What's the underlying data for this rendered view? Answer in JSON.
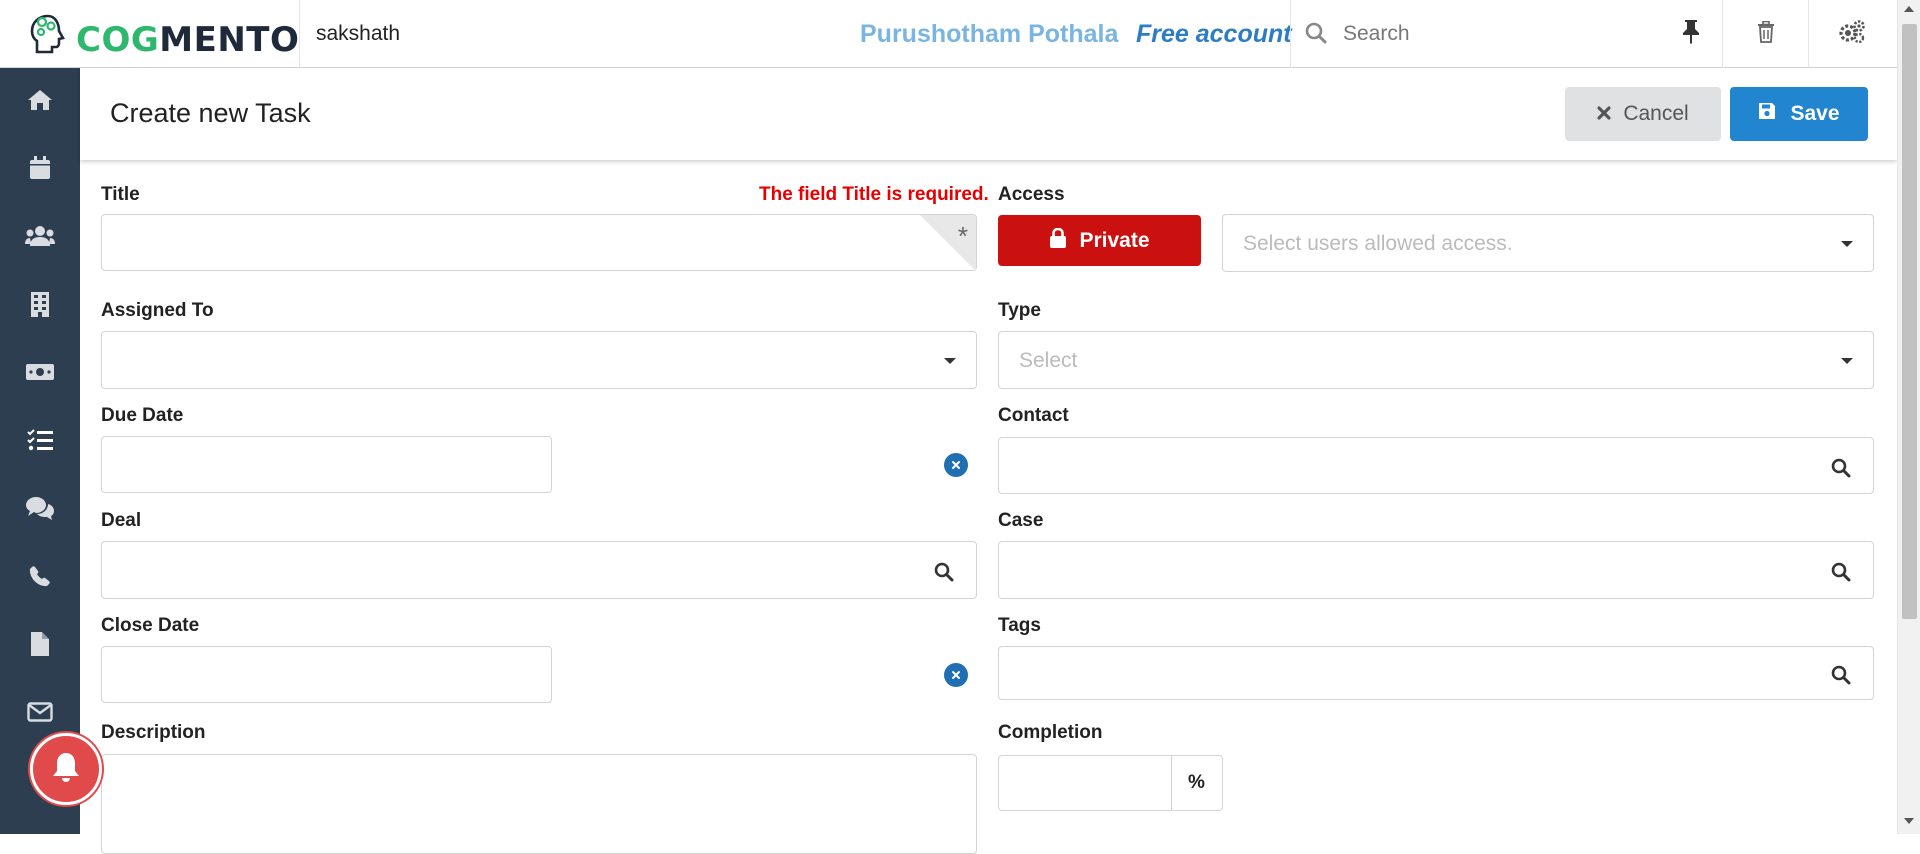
{
  "topbar": {
    "logo_prefix": "COG",
    "logo_suffix": "MENTO",
    "account_name": "sakshath",
    "user_name": "Purushotham Pothala",
    "account_type": "Free account",
    "search_placeholder": "Search",
    "icons": [
      "pin-icon",
      "trash-icon",
      "settings-gears-icon"
    ]
  },
  "sidebar": {
    "items": [
      "home-icon",
      "calendar-icon",
      "contacts-icon",
      "companies-icon",
      "deals-icon",
      "tasks-icon",
      "cases-icon",
      "calls-icon",
      "documents-icon",
      "email-icon"
    ]
  },
  "header": {
    "title": "Create new Task",
    "cancel_label": "Cancel",
    "save_label": "Save"
  },
  "form": {
    "title_label": "Title",
    "title_error": "The field Title is required.",
    "title_required_marker": "*",
    "access_label": "Access",
    "access_button": "Private",
    "access_placeholder": "Select users allowed access.",
    "assigned_to_label": "Assigned To",
    "type_label": "Type",
    "type_placeholder": "Select",
    "due_date_label": "Due Date",
    "contact_label": "Contact",
    "deal_label": "Deal",
    "case_label": "Case",
    "close_date_label": "Close Date",
    "tags_label": "Tags",
    "description_label": "Description",
    "completion_label": "Completion",
    "completion_unit": "%"
  },
  "colors": {
    "sidebar_bg": "#2d3e50",
    "save_blue": "#2185d0",
    "private_red": "#cb1010",
    "error_red": "#e60000",
    "logo_green": "#2eb86e"
  }
}
